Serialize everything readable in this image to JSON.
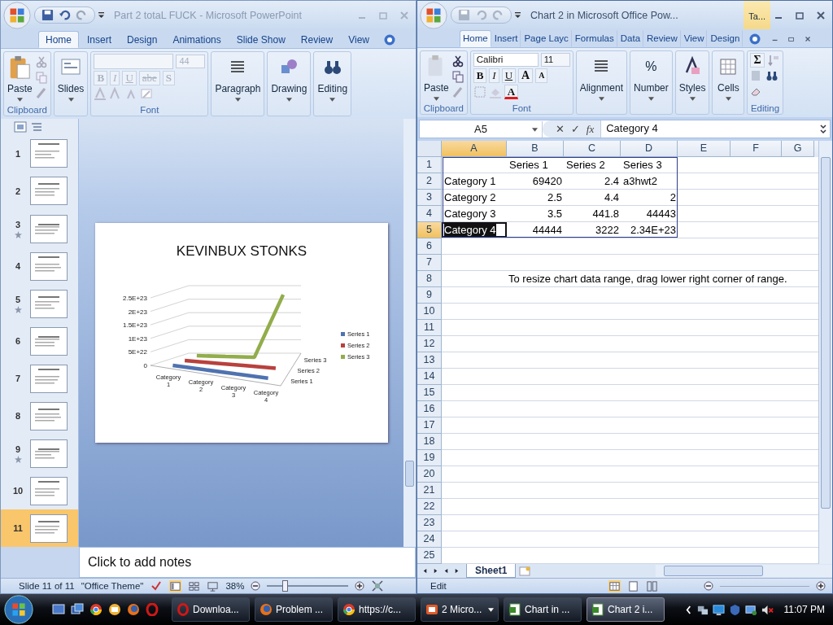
{
  "powerpoint": {
    "title": "Part 2 totaL FUCK - Microsoft PowerPoint",
    "tabs": [
      {
        "label": "Home",
        "selected": true
      },
      {
        "label": "Insert",
        "selected": false
      },
      {
        "label": "Design",
        "selected": false
      },
      {
        "label": "Animations",
        "selected": false
      },
      {
        "label": "Slide Show",
        "selected": false
      },
      {
        "label": "Review",
        "selected": false
      },
      {
        "label": "View",
        "selected": false
      }
    ],
    "ribbon": {
      "paste": "Paste",
      "clipboard": "Clipboard",
      "slides": "Slides",
      "font_size": "44",
      "font_disabled": true,
      "format_buttons": [
        "B",
        "I",
        "U",
        "abe",
        "S"
      ],
      "font": "Font",
      "paragraph": "Paragraph",
      "drawing": "Drawing",
      "editing": "Editing"
    },
    "thumbnails": [
      {
        "number": "1",
        "animated": false,
        "selected": false
      },
      {
        "number": "2",
        "animated": false,
        "selected": false
      },
      {
        "number": "3",
        "animated": true,
        "selected": false
      },
      {
        "number": "4",
        "animated": false,
        "selected": false
      },
      {
        "number": "5",
        "animated": true,
        "selected": false
      },
      {
        "number": "6",
        "animated": false,
        "selected": false
      },
      {
        "number": "7",
        "animated": false,
        "selected": false
      },
      {
        "number": "8",
        "animated": false,
        "selected": false
      },
      {
        "number": "9",
        "animated": true,
        "selected": false
      },
      {
        "number": "10",
        "animated": false,
        "selected": false
      },
      {
        "number": "11",
        "animated": false,
        "selected": true
      }
    ],
    "slide": {
      "chart": {
        "title": "KEVINBUX STONKS",
        "value_axis_labels": [
          "2.5E+23",
          "2E+23",
          "1.5E+23",
          "1E+23",
          "5E+22",
          "0"
        ],
        "category_labels": [
          "Category 1",
          "Category 2",
          "Category 3",
          "Category 4"
        ],
        "series_axis_labels": [
          "Series 3",
          "Series 2",
          "Series 1"
        ],
        "legend": [
          {
            "name": "Series 1",
            "color": "#4f72b0"
          },
          {
            "name": "Series 2",
            "color": "#b8413d"
          },
          {
            "name": "Series 3",
            "color": "#92ad4b"
          }
        ]
      }
    },
    "notes": {
      "placeholder": "Click to add notes"
    },
    "status_bar": {
      "slide": "Slide 11 of 11",
      "theme": "\"Office Theme\"",
      "zoom": "38%",
      "zoom_slider": {
        "level": 0.22
      }
    }
  },
  "excel": {
    "title": "Chart 2 in Microsoft Office Pow...",
    "context_tab": "Ta...",
    "tabs": [
      {
        "label": "Home",
        "selected": true
      },
      {
        "label": "Insert",
        "selected": false
      },
      {
        "label": "Page Layc",
        "selected": false
      },
      {
        "label": "Formulas",
        "selected": false
      },
      {
        "label": "Data",
        "selected": false
      },
      {
        "label": "Review",
        "selected": false
      },
      {
        "label": "View",
        "selected": false
      },
      {
        "label": "Design",
        "selected": false
      }
    ],
    "ribbon": {
      "paste": "Paste",
      "clipboard": "Clipboard",
      "font_name": "Calibri",
      "font_size": "11",
      "format_buttons": [
        "B",
        "I",
        "U"
      ],
      "size_buttons": [
        "A",
        "A"
      ],
      "font_color": "A",
      "font": "Font",
      "alignment": "Alignment",
      "number_symbol": "%",
      "number": "Number",
      "styles": "Styles",
      "cells": "Cells",
      "sum_symbol": "Σ",
      "editing": "Editing"
    },
    "formula_bar": {
      "name_box": "A5",
      "buttons": [
        "✕",
        "✓",
        "fx"
      ],
      "value": "Category 4"
    },
    "columns": [
      {
        "label": "A",
        "selected": true
      },
      {
        "label": "B",
        "selected": false
      },
      {
        "label": "C",
        "selected": false
      },
      {
        "label": "D",
        "selected": false
      },
      {
        "label": "E",
        "selected": false
      },
      {
        "label": "F",
        "selected": false
      },
      {
        "label": "G",
        "selected": false
      }
    ],
    "rows": [
      {
        "header": "1",
        "selected": false,
        "cells": {
          "B": {
            "text": "Series 1",
            "kind": "text",
            "selected": false
          },
          "C": {
            "text": "Series 2",
            "kind": "text",
            "selected": false
          },
          "D": {
            "text": "Series 3",
            "kind": "text",
            "selected": false
          }
        }
      },
      {
        "header": "2",
        "selected": false,
        "cells": {
          "A": {
            "text": "Category 1",
            "kind": "text",
            "selected": false
          },
          "B": {
            "text": "69420",
            "kind": "number",
            "selected": false
          },
          "C": {
            "text": "2.4",
            "kind": "number",
            "selected": false
          },
          "D": {
            "text": "a3hwt2",
            "kind": "text",
            "selected": false
          }
        }
      },
      {
        "header": "3",
        "selected": false,
        "cells": {
          "A": {
            "text": "Category 2",
            "kind": "text",
            "selected": false
          },
          "B": {
            "text": "2.5",
            "kind": "number",
            "selected": false
          },
          "C": {
            "text": "4.4",
            "kind": "number",
            "selected": false
          },
          "D": {
            "text": "2",
            "kind": "number",
            "selected": false
          }
        }
      },
      {
        "header": "4",
        "selected": false,
        "cells": {
          "A": {
            "text": "Category 3",
            "kind": "text",
            "selected": false
          },
          "B": {
            "text": "3.5",
            "kind": "number",
            "selected": false
          },
          "C": {
            "text": "441.8",
            "kind": "number",
            "selected": false
          },
          "D": {
            "text": "44443",
            "kind": "number",
            "selected": false
          }
        }
      },
      {
        "header": "5",
        "selected": true,
        "cells": {
          "A": {
            "text": "Category 4",
            "kind": "text",
            "selected": true
          },
          "B": {
            "text": "44444",
            "kind": "number",
            "selected": false
          },
          "C": {
            "text": "3222",
            "kind": "number",
            "selected": false
          },
          "D": {
            "text": "2.34E+23",
            "kind": "number",
            "selected": false
          }
        }
      },
      {
        "header": "6",
        "selected": false
      },
      {
        "header": "7",
        "selected": false
      },
      {
        "header": "8",
        "selected": false,
        "cells": {
          "B": {
            "text": "To resize chart data range, drag lower right corner of range.",
            "kind": "note",
            "selected": false
          }
        }
      },
      {
        "header": "9",
        "selected": false
      },
      {
        "header": "10",
        "selected": false
      },
      {
        "header": "11",
        "selected": false
      },
      {
        "header": "12",
        "selected": false
      },
      {
        "header": "13",
        "selected": false
      },
      {
        "header": "14",
        "selected": false
      },
      {
        "header": "15",
        "selected": false
      },
      {
        "header": "16",
        "selected": false
      },
      {
        "header": "17",
        "selected": false
      },
      {
        "header": "18",
        "selected": false
      },
      {
        "header": "19",
        "selected": false
      },
      {
        "header": "20",
        "selected": false
      },
      {
        "header": "21",
        "selected": false
      },
      {
        "header": "22",
        "selected": false
      },
      {
        "header": "23",
        "selected": false
      },
      {
        "header": "24",
        "selected": false
      },
      {
        "header": "25",
        "selected": false
      }
    ],
    "sheet_tabs": [
      {
        "label": "Sheet1",
        "selected": true
      }
    ],
    "status_bar": {
      "mode": "Edit"
    }
  },
  "taskbar": {
    "tasks": [
      {
        "label": "Downloa...",
        "selected": false
      },
      {
        "label": "Problem ...",
        "selected": false
      },
      {
        "label": "https://c...",
        "selected": false
      },
      {
        "label": "2 Micro...",
        "selected": false
      },
      {
        "label": "Chart in ...",
        "selected": false
      },
      {
        "label": "Chart 2 i...",
        "selected": true
      }
    ],
    "clock": "11:07 PM"
  }
}
